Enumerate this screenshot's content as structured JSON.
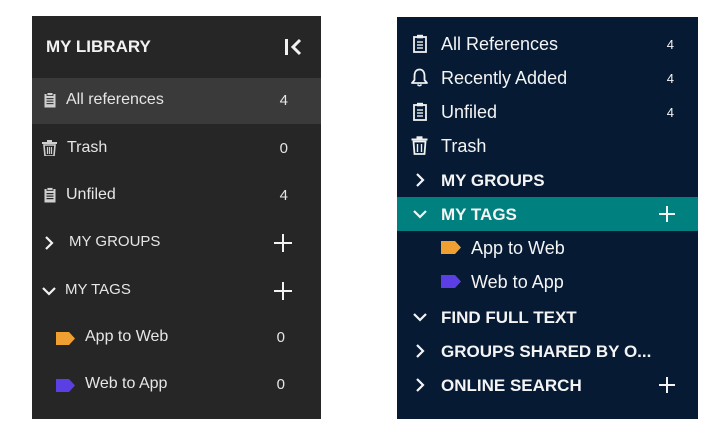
{
  "left_panel": {
    "title": "MY LIBRARY",
    "items": [
      {
        "label": "All references",
        "count": "4",
        "icon": "clipboard-icon"
      },
      {
        "label": "Trash",
        "count": "0",
        "icon": "trash-icon"
      },
      {
        "label": "Unfiled",
        "count": "4",
        "icon": "clipboard-icon"
      }
    ],
    "sections": [
      {
        "label": "MY GROUPS",
        "expanded": false
      },
      {
        "label": "MY TAGS",
        "expanded": true
      }
    ],
    "tags": [
      {
        "label": "App to Web",
        "count": "0",
        "color": "#f0a030"
      },
      {
        "label": "Web to App",
        "count": "0",
        "color": "#5b3fe4"
      }
    ]
  },
  "right_panel": {
    "items": [
      {
        "label": "All References",
        "count": "4",
        "icon": "clipboard-icon"
      },
      {
        "label": "Recently Added",
        "count": "4",
        "icon": "bell-icon"
      },
      {
        "label": "Unfiled",
        "count": "4",
        "icon": "clipboard-icon"
      },
      {
        "label": "Trash",
        "icon": "trash-icon"
      }
    ],
    "sections": [
      {
        "label": "MY GROUPS",
        "expanded": false
      },
      {
        "label": "MY TAGS",
        "expanded": true
      },
      {
        "label": "FIND FULL TEXT",
        "expanded": true
      },
      {
        "label": "GROUPS SHARED BY O...",
        "expanded": false
      },
      {
        "label": "ONLINE SEARCH",
        "expanded": false
      }
    ],
    "tags": [
      {
        "label": "App to Web",
        "color": "#f0a030"
      },
      {
        "label": "Web to App",
        "color": "#5b3fe4"
      }
    ]
  },
  "colors": {
    "left_background": "#262626",
    "left_selected": "#3a3a3a",
    "right_background": "#061a34",
    "right_selected": "#00817f"
  }
}
